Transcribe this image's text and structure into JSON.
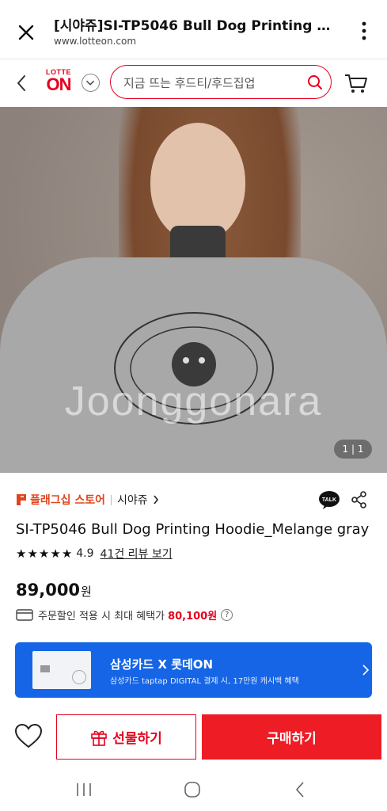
{
  "browser": {
    "title": "[시야쥬]SI-TP5046 Bull Dog Printing Hoodie_Melange gray",
    "url": "www.lotteon.com"
  },
  "header": {
    "logo_top": "LOTTE",
    "logo_main": "ON",
    "search_placeholder": "지금 뜨는 후드티/후드집업"
  },
  "gallery": {
    "watermark": "Joonggonara",
    "counter": "1 | 1"
  },
  "product": {
    "store_label": "플래그십 스토어",
    "brand": "시야쥬",
    "talk_label": "TALK",
    "title": "SI-TP5046 Bull Dog Printing Hoodie_Melange gray",
    "rating": 4.9,
    "rating_text": "4.9",
    "stars": 5,
    "reviews_link": "41건 리뷰 보기",
    "price": "89,000",
    "currency": "원",
    "benefit_text": "주문할인 적용 시 최대 혜택가",
    "benefit_price": "80,100원",
    "help": "?"
  },
  "banner": {
    "title": "삼성카드 X 롯데ON",
    "subtitle": "삼성카드 taptap DIGITAL 결제 시, 17만원 캐시백 혜택",
    "bg_color": "#1565e6"
  },
  "actions": {
    "gift_label": "선물하기",
    "buy_label": "구매하기",
    "accent": "#ee1c25"
  }
}
